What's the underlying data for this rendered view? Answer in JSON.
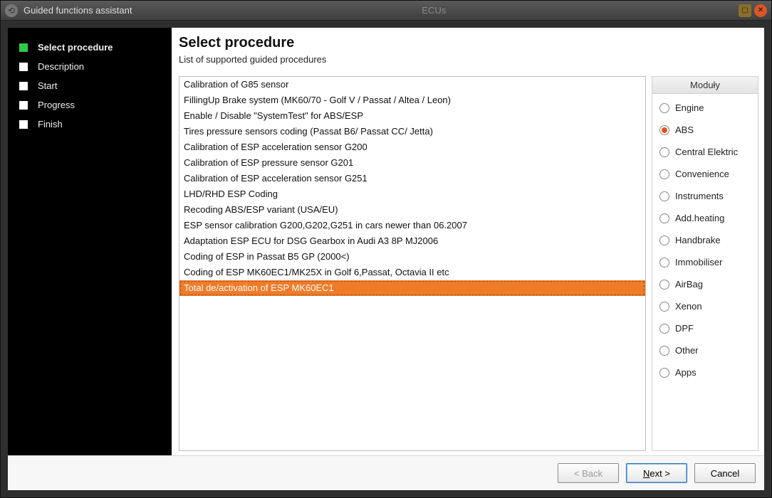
{
  "window": {
    "title": "Guided functions assistant",
    "center_label": "ECUs"
  },
  "sidebar": {
    "steps": [
      {
        "label": "Select procedure",
        "active": true
      },
      {
        "label": "Description",
        "active": false
      },
      {
        "label": "Start",
        "active": false
      },
      {
        "label": "Progress",
        "active": false
      },
      {
        "label": "Finish",
        "active": false
      }
    ]
  },
  "main": {
    "heading": "Select procedure",
    "subtitle": "List of supported guided procedures"
  },
  "procedures": {
    "selected_index": 13,
    "items": [
      "Calibration of G85 sensor",
      "FillingUp Brake system (MK60/70 - Golf V / Passat / Altea / Leon)",
      "Enable / Disable \"SystemTest\" for ABS/ESP",
      "Tires pressure sensors coding (Passat B6/ Passat CC/ Jetta)",
      "Calibration of ESP acceleration sensor G200",
      "Calibration of ESP pressure sensor G201",
      "Calibration of ESP acceleration sensor G251",
      "LHD/RHD ESP Coding",
      "Recoding ABS/ESP variant (USA/EU)",
      "ESP sensor calibration G200,G202,G251 in cars newer than 06.2007",
      "Adaptation ESP ECU for DSG Gearbox in Audi A3 8P MJ2006",
      "Coding of ESP in Passat B5 GP (2000<)",
      "Coding of ESP MK60EC1/MK25X in Golf 6,Passat, Octavia II etc",
      "Total de/activation of ESP MK60EC1"
    ]
  },
  "modules": {
    "header": "Moduły",
    "selected_index": 1,
    "items": [
      "Engine",
      "ABS",
      "Central Elektric",
      "Convenience",
      "Instruments",
      "Add.heating",
      "Handbrake",
      "Immobiliser",
      "AirBag",
      "Xenon",
      "DPF",
      "Other",
      "Apps"
    ]
  },
  "footer": {
    "back": "< Back",
    "next": "Next >",
    "cancel": "Cancel"
  }
}
